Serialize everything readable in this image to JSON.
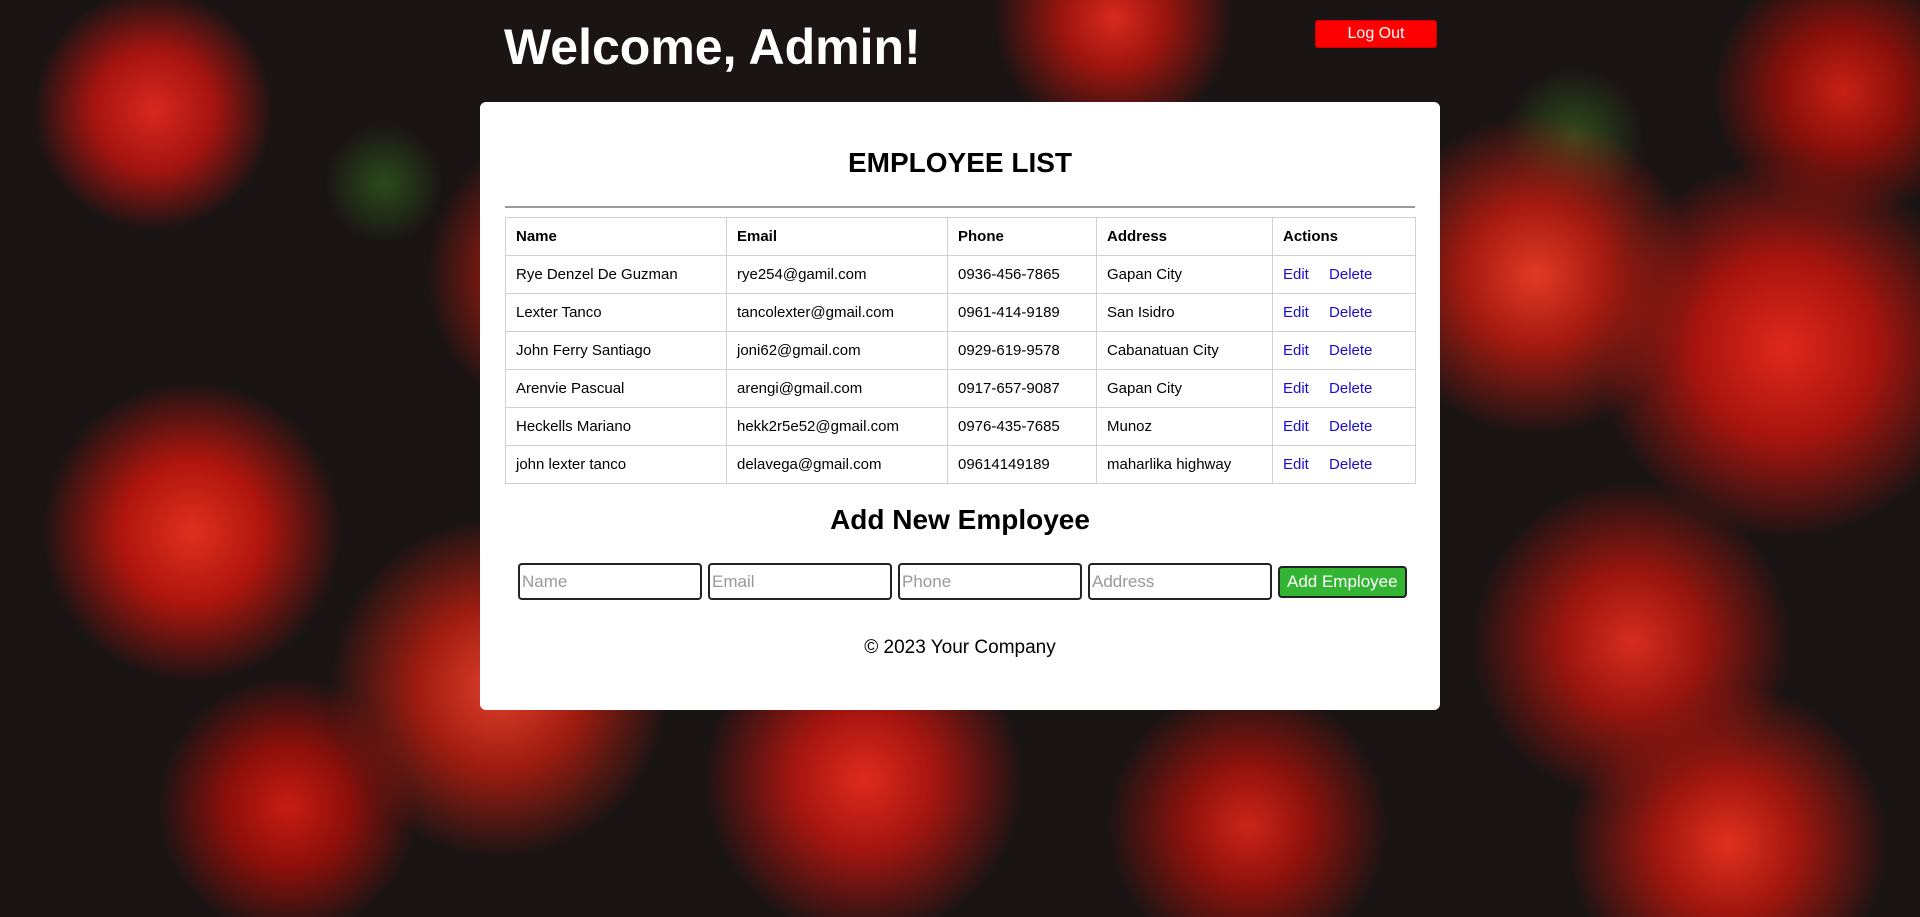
{
  "header": {
    "title": "Welcome, Admin!",
    "logout_label": "Log Out"
  },
  "employee_list": {
    "title": "EMPLOYEE LIST",
    "columns": {
      "name": "Name",
      "email": "Email",
      "phone": "Phone",
      "address": "Address",
      "actions": "Actions"
    },
    "rows": [
      {
        "name": "Rye Denzel De Guzman",
        "email": "rye254@gamil.com",
        "phone": "0936-456-7865",
        "address": "Gapan City",
        "edit": "Edit",
        "delete": "Delete"
      },
      {
        "name": "Lexter Tanco",
        "email": "tancolexter@gmail.com",
        "phone": "0961-414-9189",
        "address": "San Isidro",
        "edit": "Edit",
        "delete": "Delete"
      },
      {
        "name": "John Ferry Santiago",
        "email": "joni62@gmail.com",
        "phone": "0929-619-9578",
        "address": "Cabanatuan City",
        "edit": "Edit",
        "delete": "Delete"
      },
      {
        "name": "Arenvie Pascual",
        "email": "arengi@gmail.com",
        "phone": "0917-657-9087",
        "address": "Gapan City",
        "edit": "Edit",
        "delete": "Delete"
      },
      {
        "name": "Heckells Mariano",
        "email": "hekk2r5e52@gmail.com",
        "phone": "0976-435-7685",
        "address": "Munoz",
        "edit": "Edit",
        "delete": "Delete"
      },
      {
        "name": "john lexter tanco",
        "email": "delavega@gmail.com",
        "phone": "09614149189",
        "address": "maharlika highway",
        "edit": "Edit",
        "delete": "Delete"
      }
    ]
  },
  "add_employee": {
    "title": "Add New Employee",
    "name_placeholder": "Name",
    "email_placeholder": "Email",
    "phone_placeholder": "Phone",
    "address_placeholder": "Address",
    "submit_label": "Add Employee"
  },
  "footer": {
    "text": "© 2023 Your Company"
  },
  "colors": {
    "logout_button": "#ff0000",
    "add_button": "#33b533",
    "link": "#1a0dcc"
  }
}
